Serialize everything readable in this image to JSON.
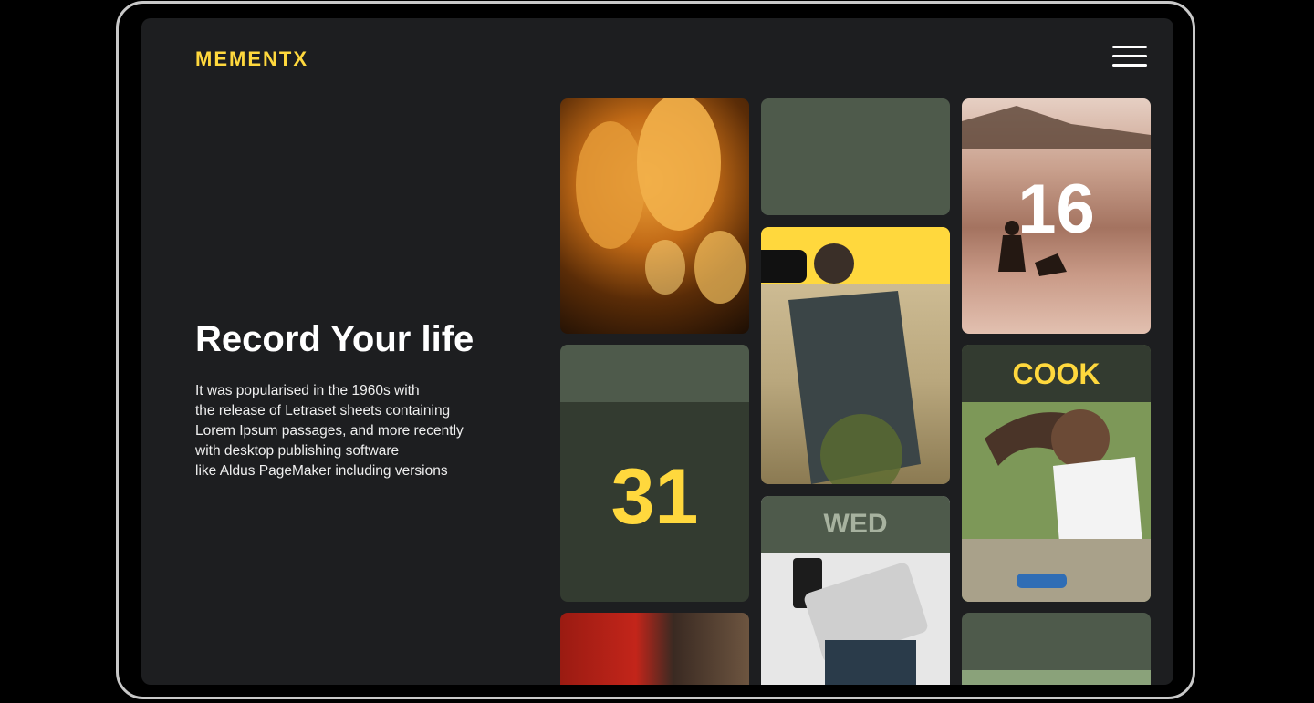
{
  "brand": {
    "logo": "MEMENTX"
  },
  "hero": {
    "title": "Record Your life",
    "lines": [
      "It was popularised in the 1960s with",
      "the release of Letraset sheets containing",
      "Lorem Ipsum passages, and more recently",
      "with desktop publishing software",
      "like Aldus PageMaker including versions"
    ]
  },
  "tiles": {
    "date_day": "16",
    "date_big": "31",
    "weekday": "WED",
    "activity": "COOK"
  },
  "colors": {
    "accent": "#ffd83d",
    "tile_dark": "#333b30",
    "tile_mid": "#4e5a4b",
    "screen": "#1d1e20"
  },
  "icons": {
    "menu": "hamburger-menu-icon"
  }
}
